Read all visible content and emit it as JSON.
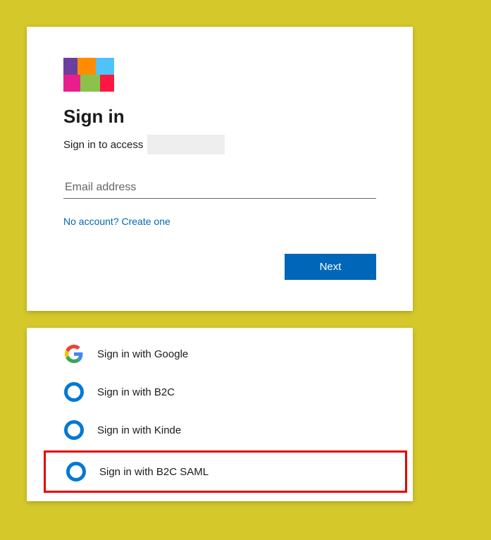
{
  "signin": {
    "title": "Sign in",
    "subtitle_prefix": "Sign in to access",
    "email_placeholder": "Email address",
    "email_value": "",
    "create_link": "No account? Create one",
    "next_button": "Next"
  },
  "providers": {
    "google": "Sign in with Google",
    "b2c": "Sign in with B2C",
    "kinde": "Sign in with Kinde",
    "b2c_saml": "Sign in with B2C SAML"
  }
}
